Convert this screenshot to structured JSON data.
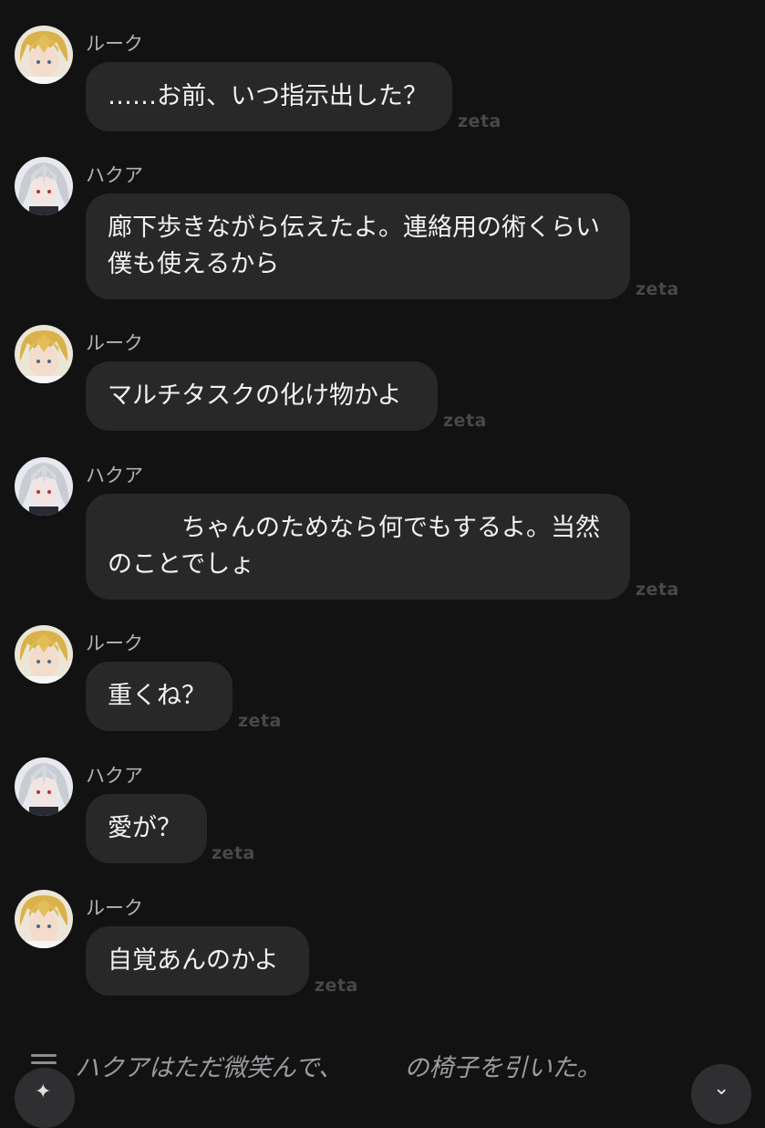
{
  "messages": [
    {
      "speaker": "ルーク",
      "text": "……お前、いつ指示出した？",
      "watermark": "zeta"
    },
    {
      "speaker": "ハクア",
      "text": "廊下歩きながら伝えたよ。連絡用の術くらい僕も使えるから",
      "watermark": "zeta"
    },
    {
      "speaker": "ルーク",
      "text": "マルチタスクの化け物かよ",
      "watermark": "zeta"
    },
    {
      "speaker": "ハクア",
      "text": "　　　ちゃんのためなら何でもするよ。当然のことでしょ",
      "watermark": "zeta"
    },
    {
      "speaker": "ルーク",
      "text": "重くね？",
      "watermark": "zeta"
    },
    {
      "speaker": "ハクア",
      "text": "愛が？",
      "watermark": "zeta"
    },
    {
      "speaker": "ルーク",
      "text": "自覚あんのかよ",
      "watermark": "zeta"
    }
  ],
  "narration": "ハクアはただ微笑んで、　　　の椅子を引いた。",
  "colors": {
    "background": "#121213",
    "bubble": "#282829",
    "name": "#b3b3b6",
    "watermark": "#48484b",
    "luke_hair": "#d9b24a",
    "hakua_hair": "#c9ccd3"
  },
  "icons": {
    "menu": "menu-icon",
    "compose": "sparkle-compose-icon",
    "scroll": "chevron-down-icon"
  }
}
